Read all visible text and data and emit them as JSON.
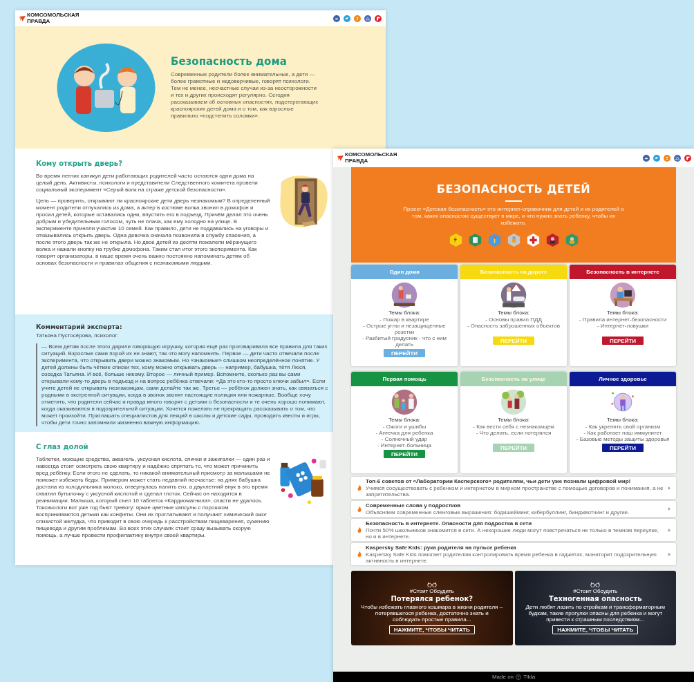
{
  "left_page": {
    "logo": {
      "line_1": "КОМСОМОЛЬСКАЯ",
      "line_2": "ПРАВДА"
    },
    "hero": {
      "title": "Безопасность дома",
      "text": "Современные родители более внимательные, а дети — более грамотные и недоверчивые, говорят психологи. Тем не менее, несчастные случаи из-за неосторожности и тех и других происходят регулярно. Сегодня рассказываем об основных опасностях, подстерегающих красноярских детей дома и о том, как взрослые правильно «подстелить соломки»."
    },
    "door_section": {
      "title": "Кому открыть дверь?",
      "paragraphs": [
        "Во время летних каникул дети работающих родителей часто остаются одни дома на целый день. Активисты, психологи и представители Следственного комитета провели социальный эксперимент «Серый волк на страже детской безопасности».",
        "Цель — проверить, открывают ли красноярские дети дверь незнакомым? В определенный момент родители отлучались из дома, а актер в костюме волка звонил в домофон и просил детей, которые оставались одни, впустить его в подъезд. Причём делал это очень добрым и убедительным голосом, чуть не плача, как ему холодно на улице. В эксперименте приняли участие 10 семей. Как правило, дети не поддавались на уговоры и отказывались открыть дверь. Одна девочка сначала позвонила в службу спасения, а после этого дверь так же не открыла. Но двое детей из десяти пожалели мёрзнущего волка и нажали кнопку на трубке домофона. Таким стал итог этого эксперимента. Как говорят организаторы, в наше время очень важно постоянно напоминать детям об основах безопасности и правилах общения с незнакомыми людьми."
      ]
    },
    "expert_section": {
      "title": "Комментарий эксперта:",
      "author": "Татьяна Пустосёрова, психолог:",
      "quote": "— Всем детям после этого дарили говорящую игрушку, которая ещё раз проговаривала все правила для таких ситуаций. Взрослые сами порой их не знают, так что могу напомнить. Первое — дети часто отвечали после эксперимента, что открывать двери можно знакомым. Но «знакомые» слишком неопределённое понятие. У детей должны быть чёткие списки тех, кому можно открывать дверь — например, бабушка, тётя Люся, соседка Татьяна. И всё, больше никому. Второе — личный пример. Вспомните, сколько раз вы сами открывали кому-то дверь в подъезд и на вопрос ребёнка отвечали: «Да это кто-то просто ключи забыл». Если учите детей не открывать незнакомцам, сами делайте так же. Третье — ребёнок должен знать, как связаться с родными в экстренной ситуации, когда в звонок звонят настоящие полиция или пожарные. Вообще хочу отметить, что родители сейчас и правда много говорят с детьми о безопасности и те очень хорошо понимают, когда оказываются в подозрительной ситуации. Хочется пожелать не прекращать рассказывать о том, что может произойти. Приглашать специалистов для лекций в школы и детские сады, проводить квесты и игры, чтобы дети точно запомнили жизненно важную информацию."
    },
    "pills_section": {
      "title": "С глаз долой",
      "text": "Таблетки, моющие средства, аквагель, уксусная кислота, спички и зажигалки — один раз и навсегда стоит осмотреть свою квартиру и надёжно спрятать то, что может причинить вред ребёнку. Если этого не сделать, то никакой внимательный присмотр за малышами не поможет избежать беды. Примером может стать недавний несчастье: на днях бабушка достала из холодильника молоко, отвернулась налить его, а двухлетний внук в это время схватил бутылочку с уксусной кислотой и сделал глоток. Сейчас он находится в реанимации. Малыша, который съел 10 таблеток «Кардиомагнила», спасти не удалось. Токсикологи вот уже год бьют тревогу: яркие цветные капсулы с порошком воспринимаются детьми как конфеты. Они их проглатывают и получают химический ожог слизистой желудка, что приводит в свою очередь к расстройствам пищеварения, сужению пищевода и другим проблемам. Во всех этих случаях стоит сразу вызывать скорую помощь, а лучше провести профилактику внутри своей квартиры."
    }
  },
  "right_page": {
    "logo": {
      "line_1": "КОМСОМОЛЬСКАЯ",
      "line_2": "ПРАВДА"
    },
    "hero": {
      "title": "БЕЗОПАСНОСТЬ ДЕТЕЙ",
      "text": "Проект «Детская безопасность» это интернет-справочник для детей и их родителей о том, каких опасностях существует в мире, и что нужно знать ребенку, чтобы их избежать."
    },
    "cards": [
      {
        "title": "Один дома",
        "color": "#6aafe0",
        "topics_heading": "Темы блока:",
        "topics": [
          "- Пожар в квартире",
          "- Острые углы и незащищенные розетки",
          "- Разбитый градусник - что с ним делать"
        ],
        "button": "ПЕРЕЙТИ"
      },
      {
        "title": "Безопасность на дороге",
        "color": "#f6d90f",
        "topics_heading": "Темы блока:",
        "topics": [
          "- Основы правил ПДД",
          "- Опасность заброшенных объектов"
        ],
        "button": "ПЕРЕЙТИ"
      },
      {
        "title": "Безопасность в интернете",
        "color": "#c0172d",
        "topics_heading": "Темы блока:",
        "topics": [
          "- Правила интернет-безопасности",
          "- Интернет-ловушки"
        ],
        "button": "ПЕРЕЙТИ"
      },
      {
        "title": "Первая помощь",
        "color": "#169444",
        "topics_heading": "Темы блока:",
        "topics": [
          "- Ожоги и ушибы",
          "- Аптечка для ребенка",
          "- Солнечный удар",
          "- Интернет-больница"
        ],
        "button": "ПЕРЕЙТИ"
      },
      {
        "title": "Безопасность на улице",
        "color": "#a6d3b1",
        "topics_heading": "Темы блока:",
        "topics": [
          "- Как вести себя с незнакомцем",
          "- Что делать, если потерялся"
        ],
        "button": "ПЕРЕЙТИ"
      },
      {
        "title": "Личное здоровье",
        "color": "#0c1a96",
        "topics_heading": "Темы блока:",
        "topics": [
          "- Как укрепить свой организм",
          "- Как работает наш иммунитет",
          "- Базовые методы защиты здоровья"
        ],
        "button": "ПЕРЕЙТИ"
      }
    ],
    "articles": [
      {
        "title": "Топ-6 советов от «Лаборатории Касперского» родителям, чьи дети уже познали цифровой мир!",
        "text": "Учимся сосуществовать с ребенком и интернетом в мирном пространстве с помощью договоров и понимания, а не запретительства."
      },
      {
        "title": "Современные слова у подростков",
        "text": "Объясняем современные сленговые выражения: бодишейминг, кибербуллинг, бинджвотчинг и другие."
      },
      {
        "title": "Безопасность в интернете. Опасности для подростка в сети",
        "text": "Почти 50% школьников знакомится в сети. А нехорошие люди могут повстречаться не только в темном переулке, но и в интернете."
      },
      {
        "title": "Kaspersky Safe Kids: рука родителя на пульсе ребенка",
        "text": "Kaspersky Safe Kids помогает родителям контролировать время ребенка в гаджетах, мониторит подозрительную активность в интернете."
      }
    ],
    "stories": [
      {
        "tag": "#Стоит Обсудить",
        "title": "Потерялся ребенок?",
        "text": "Чтобы избежать главного кошмара в жизни родителя – потерявшегося ребенка, достаточно знать и соблюдать простые правила...",
        "button": "НАЖМИТЕ, ЧТОБЫ ЧИТАТЬ"
      },
      {
        "tag": "#Стоит Обсудить",
        "title": "Техногенная опасность",
        "text": "Дети любят лазить по стройкам и трансформаторным будкам, такие прогулки опасны для ребенка и могут привести к страшным последствиям...",
        "button": "НАЖМИТЕ, ЧТОБЫ ЧИТАТЬ"
      }
    ],
    "footer": {
      "made_on": "Made on",
      "brand": "Tilda"
    }
  }
}
